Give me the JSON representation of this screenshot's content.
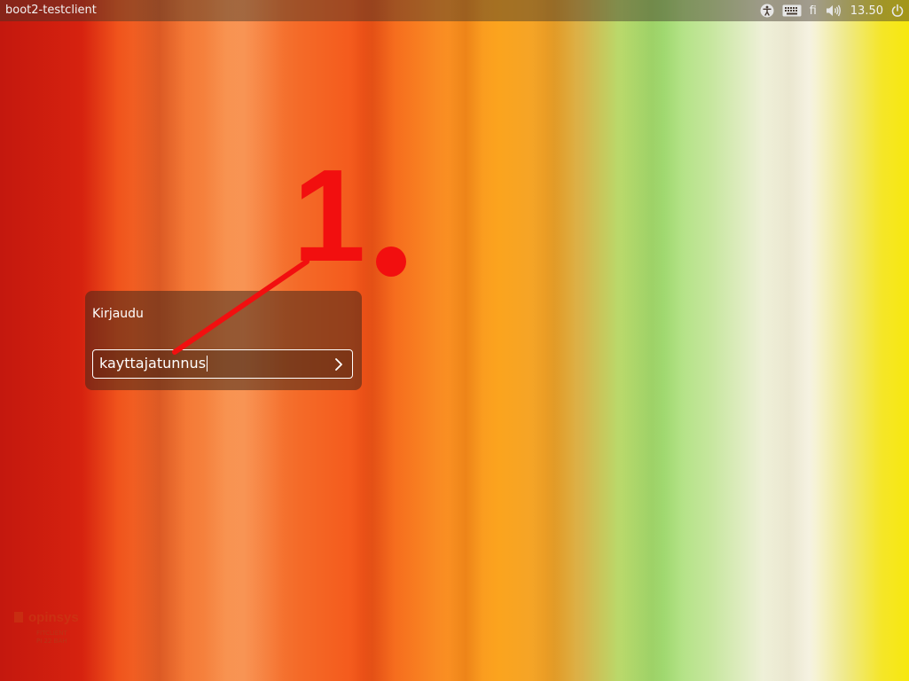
{
  "topbar": {
    "hostname": "boot2-testclient",
    "language": "fi",
    "clock": "13.50",
    "tray_icons": [
      "accessibility-icon",
      "keyboard-icon",
      "volume-icon",
      "power-icon"
    ]
  },
  "login": {
    "title": "Kirjaudu",
    "username_value": "kayttajatunnus",
    "submit_icon": "chevron-right-icon"
  },
  "annotation": {
    "step_label": "1.",
    "color": "#f20f0f"
  },
  "branding": {
    "name": "opinsys",
    "line1": "FITCLIENT",
    "line2": "PI 22 BAH"
  },
  "colors": {
    "topbar_bg": "rgba(60,50,40,0.45)",
    "panel_bg": "rgba(70,40,25,0.55)",
    "text": "#ffffff"
  }
}
